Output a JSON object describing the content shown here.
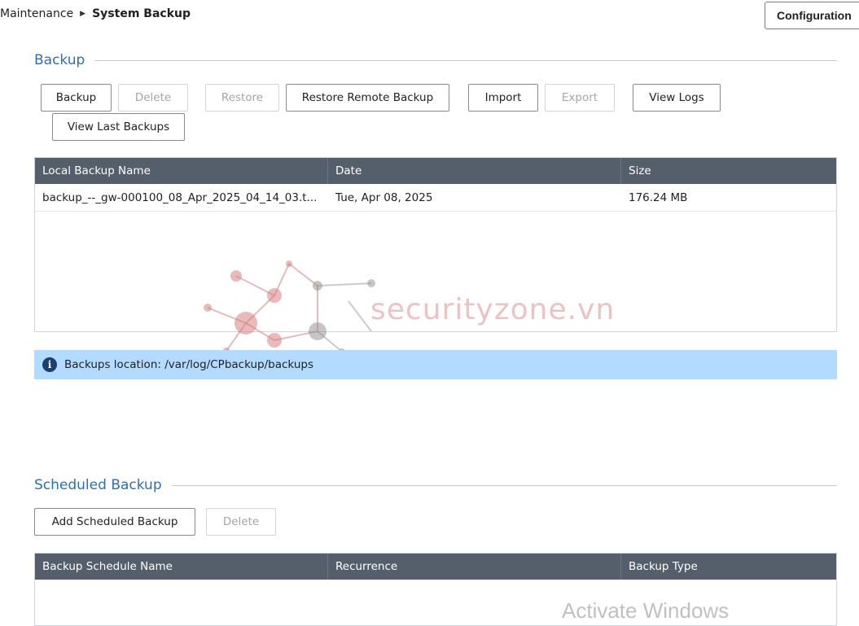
{
  "breadcrumb": {
    "parent": "Maintenance",
    "current": "System Backup"
  },
  "config_button": "Configuration",
  "backup_section": {
    "title": "Backup",
    "buttons": {
      "backup": "Backup",
      "delete": "Delete",
      "restore": "Restore",
      "restore_remote": "Restore Remote Backup",
      "import": "Import",
      "export": "Export",
      "view_logs": "View Logs",
      "view_last": "View Last Backups"
    },
    "table": {
      "headers": [
        "Local Backup Name",
        "Date",
        "Size"
      ],
      "rows": [
        [
          "backup_--_gw-000100_08_Apr_2025_04_14_03.t...",
          "Tue, Apr 08, 2025",
          "176.24 MB"
        ]
      ]
    },
    "info": "Backups location: /var/log/CPbackup/backups"
  },
  "scheduled_section": {
    "title": "Scheduled Backup",
    "buttons": {
      "add": "Add Scheduled Backup",
      "delete": "Delete"
    },
    "table": {
      "headers": [
        "Backup Schedule Name",
        "Recurrence",
        "Backup Type"
      ]
    }
  },
  "watermark": "securityzone.vn",
  "os_overlay": "Activate Windows",
  "colors": {
    "accent": "#2e6fb3",
    "header_bg": "#555f6b",
    "info_bg": "#b3dbff"
  },
  "icons": {
    "breadcrumb_separator": "caret-right-icon",
    "info": "info-icon"
  }
}
